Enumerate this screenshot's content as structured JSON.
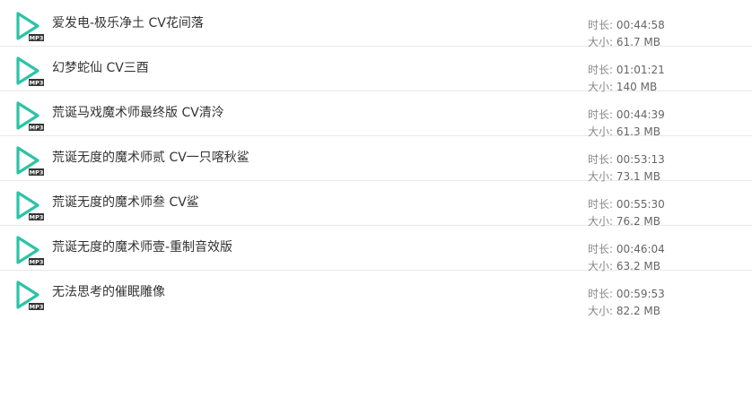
{
  "labels": {
    "duration": "时长:",
    "size": "大小:"
  },
  "icon": {
    "name": "mp3-file-icon",
    "badge": "MP3",
    "color": "#2cc3a6"
  },
  "files": [
    {
      "title": "爱发电-极乐净土 CV花间落",
      "duration": "00:44:58",
      "size": "61.7 MB"
    },
    {
      "title": "幻梦蛇仙 CV三酉",
      "duration": "01:01:21",
      "size": "140 MB"
    },
    {
      "title": "荒诞马戏魔术师最终版 CV清泠",
      "duration": "00:44:39",
      "size": "61.3 MB"
    },
    {
      "title": "荒诞无度的魔术师贰 CV一只喀秋鲨",
      "duration": "00:53:13",
      "size": "73.1 MB"
    },
    {
      "title": "荒诞无度的魔术师叁 CV鲨",
      "duration": "00:55:30",
      "size": "76.2 MB"
    },
    {
      "title": "荒诞无度的魔术师壹-重制音效版",
      "duration": "00:46:04",
      "size": "63.2 MB"
    },
    {
      "title": "无法思考的催眠雕像",
      "duration": "00:59:53",
      "size": "82.2 MB"
    }
  ]
}
